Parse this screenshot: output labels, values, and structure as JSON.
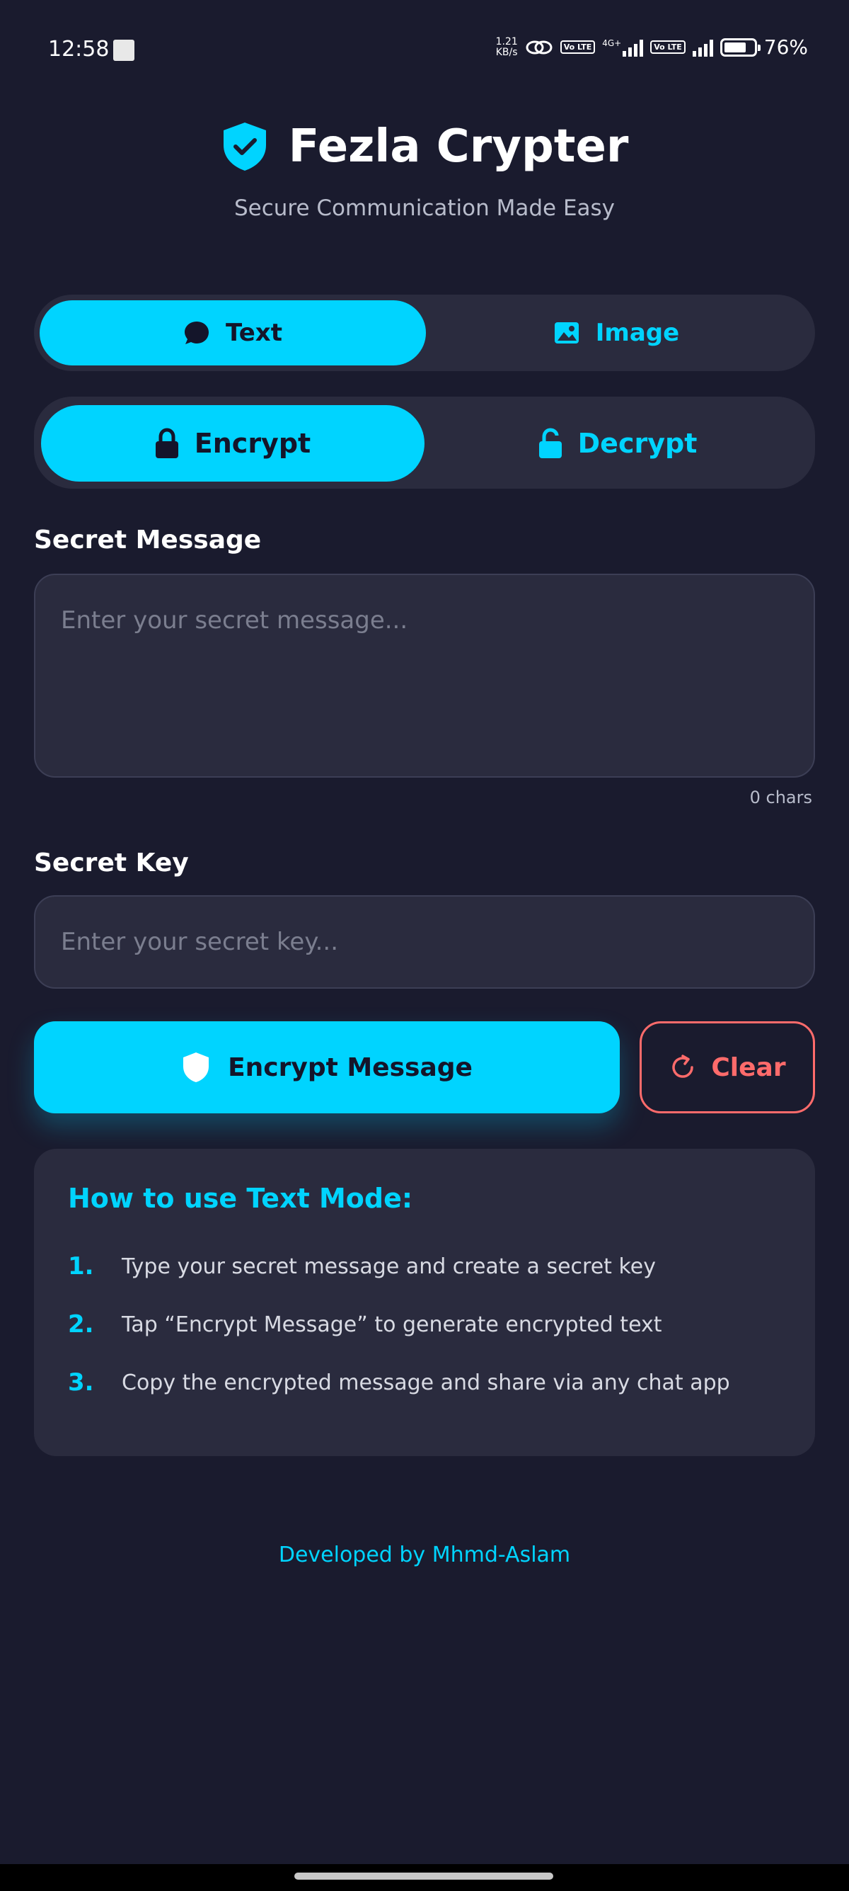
{
  "status_bar": {
    "time": "12:58",
    "net_speed_value": "1.21",
    "net_speed_unit": "KB/s",
    "volte_1": "Vo LTE",
    "network_type": "4G+",
    "volte_2": "Vo LTE",
    "battery": "76%",
    "battery_level": 0.76
  },
  "header": {
    "title": "Fezla Crypter",
    "subtitle": "Secure Communication Made Easy",
    "logo_icon": "shield-check-icon"
  },
  "mode_tabs": [
    {
      "label": "Text",
      "icon": "chat-bubble-icon",
      "active": true
    },
    {
      "label": "Image",
      "icon": "image-icon",
      "active": false
    }
  ],
  "action_tabs": [
    {
      "label": "Encrypt",
      "icon": "lock-icon",
      "active": true
    },
    {
      "label": "Decrypt",
      "icon": "unlock-icon",
      "active": false
    }
  ],
  "message": {
    "label": "Secret Message",
    "placeholder": "Enter your secret message...",
    "value": "",
    "char_count": "0 chars"
  },
  "key": {
    "label": "Secret Key",
    "placeholder": "Enter your secret key...",
    "value": ""
  },
  "buttons": {
    "encrypt_label": "Encrypt Message",
    "clear_label": "Clear"
  },
  "instructions": {
    "title": "How to use Text Mode:",
    "steps": [
      {
        "num": "1.",
        "text": "Type your secret message and create a secret key"
      },
      {
        "num": "2.",
        "text": "Tap “Encrypt Message” to generate encrypted text"
      },
      {
        "num": "3.",
        "text": "Copy the encrypted message and share via any chat app"
      }
    ]
  },
  "footer": {
    "text": "Developed by Mhmd-Aslam"
  },
  "colors": {
    "background": "#1a1b2e",
    "card": "#2a2b3e",
    "accent": "#00d4ff",
    "danger": "#ff6b6b"
  }
}
